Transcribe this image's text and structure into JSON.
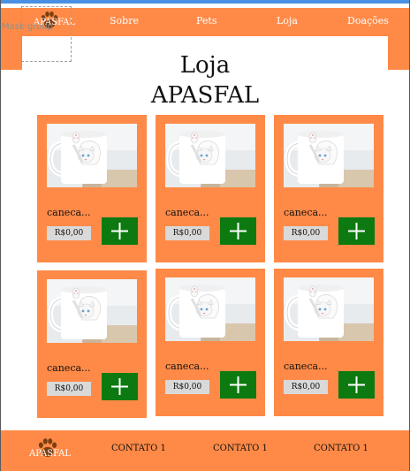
{
  "mask_label": "Mask group",
  "header": {
    "brand": "APASFAL",
    "nav": [
      "Sobre",
      "Pets",
      "Loja",
      "Doações"
    ],
    "logo_icon": "paw-icon"
  },
  "page": {
    "title_line1": "Loja",
    "title_line2": "APASFAL"
  },
  "products": [
    {
      "name": "caneca...",
      "price": "R$0,00",
      "image": "cat-mug-image",
      "button_icon": "plus-icon"
    },
    {
      "name": "caneca...",
      "price": "R$0,00",
      "image": "cat-mug-image",
      "button_icon": "plus-icon"
    },
    {
      "name": "caneca...",
      "price": "R$0,00",
      "image": "cat-mug-image",
      "button_icon": "plus-icon"
    },
    {
      "name": "caneca...",
      "price": "R$0,00",
      "image": "cat-mug-image",
      "button_icon": "plus-icon"
    },
    {
      "name": "caneca...",
      "price": "R$0,00",
      "image": "cat-mug-image",
      "button_icon": "plus-icon"
    },
    {
      "name": "caneca...",
      "price": "R$0,00",
      "image": "cat-mug-image",
      "button_icon": "plus-icon"
    }
  ],
  "footer": {
    "brand": "APASFAL",
    "contacts": [
      "CONTATO 1",
      "CONTATO 1",
      "CONTATO 1"
    ]
  },
  "colors": {
    "accent": "#ff8a47",
    "button": "#0c7a10",
    "price_bg": "#d9d9d9",
    "paw": "#7a3e10"
  }
}
